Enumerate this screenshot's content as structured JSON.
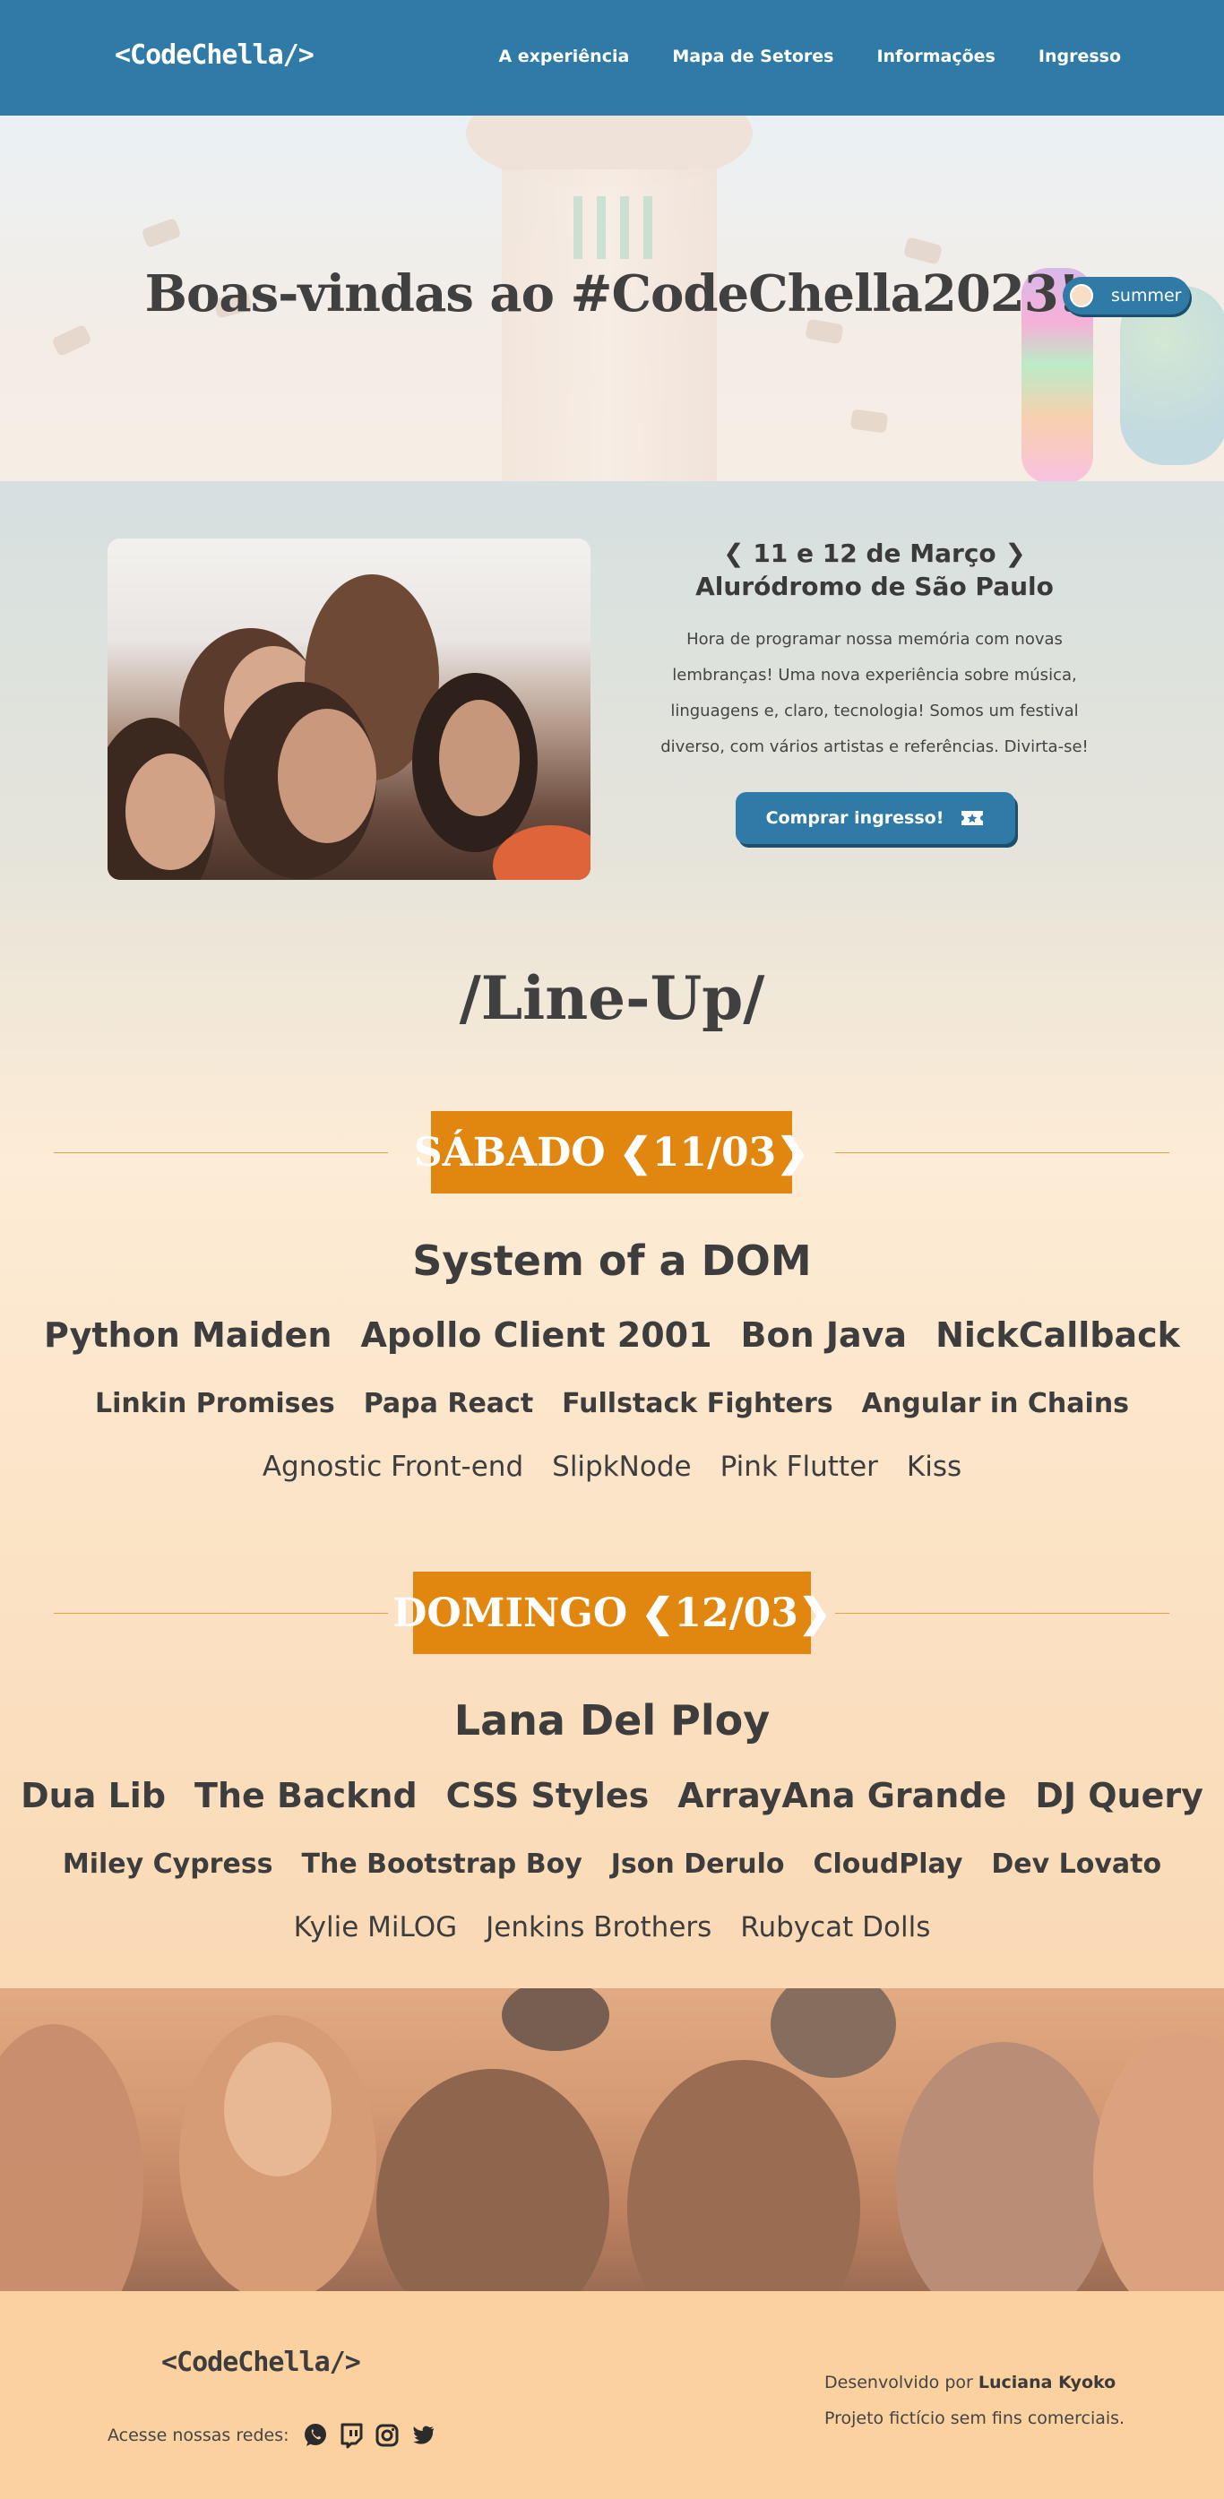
{
  "header": {
    "logo": "<CodeChella/>",
    "nav": [
      "A experiência",
      "Mapa de Setores",
      "Informações",
      "Ingresso"
    ]
  },
  "hero": {
    "title": "Boas-vindas ao #CodeChella2023!",
    "theme_toggle_label": "summer"
  },
  "intro": {
    "date": "❮ 11 e 12 de Março ❯",
    "venue": "Aluródromo de São Paulo",
    "description": "Hora de programar nossa memória com novas lembranças! Uma nova experiência sobre música, linguagens e, claro, tecnologia! Somos um festival diverso, com vários artistas e referências. Divirta-se!",
    "buy_button": "Comprar ingresso!",
    "buy_icon": "ticket-icon"
  },
  "lineup": {
    "title": "/Line-Up/",
    "days": [
      {
        "label": "SÁBADO ❮11/03❯",
        "headliner": "System of a DOM",
        "tier1": [
          "Python Maiden",
          "Apollo Client 2001",
          "Bon Java",
          "NickCallback"
        ],
        "tier2": [
          "Linkin Promises",
          "Papa React",
          "Fullstack Fighters",
          "Angular in Chains"
        ],
        "tier3": [
          "Agnostic Front-end",
          "SlipkNode",
          "Pink Flutter",
          "Kiss"
        ]
      },
      {
        "label": "DOMINGO ❮12/03❯",
        "headliner": "Lana Del Ploy",
        "tier1": [
          "Dua Lib",
          "The Backnd",
          "CSS Styles",
          "ArrayAna Grande",
          "DJ Query"
        ],
        "tier2": [
          "Miley Cypress",
          "The Bootstrap Boy",
          "Json Derulo",
          "CloudPlay",
          "Dev Lovato"
        ],
        "tier3": [
          "Kylie MiLOG",
          "Jenkins Brothers",
          "Rubycat Dolls"
        ]
      }
    ]
  },
  "footer": {
    "logo": "<CodeChella/>",
    "social_label": "Acesse nossas redes:",
    "social_icons": [
      "whatsapp-icon",
      "twitch-icon",
      "instagram-icon",
      "twitter-icon"
    ],
    "dev_prefix": "Desenvolvido por",
    "dev_name": "Luciana Kyoko",
    "disclaimer": "Projeto fictício sem fins comerciais."
  },
  "colors": {
    "primary": "#2f7aa6",
    "accent": "#e1870f",
    "text": "#3d3d3d",
    "footer_bg": "#fbd1a0"
  }
}
